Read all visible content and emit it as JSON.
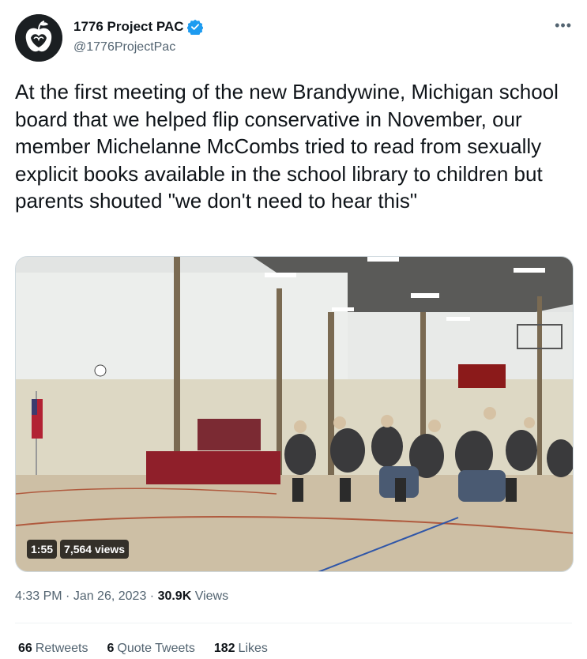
{
  "author": {
    "display_name": "1776 Project PAC",
    "handle": "@1776ProjectPac",
    "avatar_icon": "apple-logo-icon",
    "verified_icon": "verified-badge-icon",
    "verified_color": "#1d9bf0"
  },
  "more_icon": "more-options-icon",
  "tweet": {
    "text": "At the first meeting of the new Brandywine, Michigan school board that we helped flip conservative in November, our member Michelanne McCombs tried to read from sexually explicit books available in the school library to children but parents shouted \"we don't need to hear this\""
  },
  "media": {
    "duration": "1:55",
    "views": "7,564 views"
  },
  "meta": {
    "time": "4:33 PM",
    "separator1": " · ",
    "date": "Jan 26, 2023",
    "separator2": " · ",
    "views_count": "30.9K",
    "views_label": "Views"
  },
  "stats": {
    "retweets_count": "66",
    "retweets_label": "Retweets",
    "quotes_count": "6",
    "quotes_label": "Quote Tweets",
    "likes_count": "182",
    "likes_label": "Likes"
  },
  "colors": {
    "text_primary": "#0f1419",
    "text_secondary": "#536471",
    "accent": "#1d9bf0"
  }
}
